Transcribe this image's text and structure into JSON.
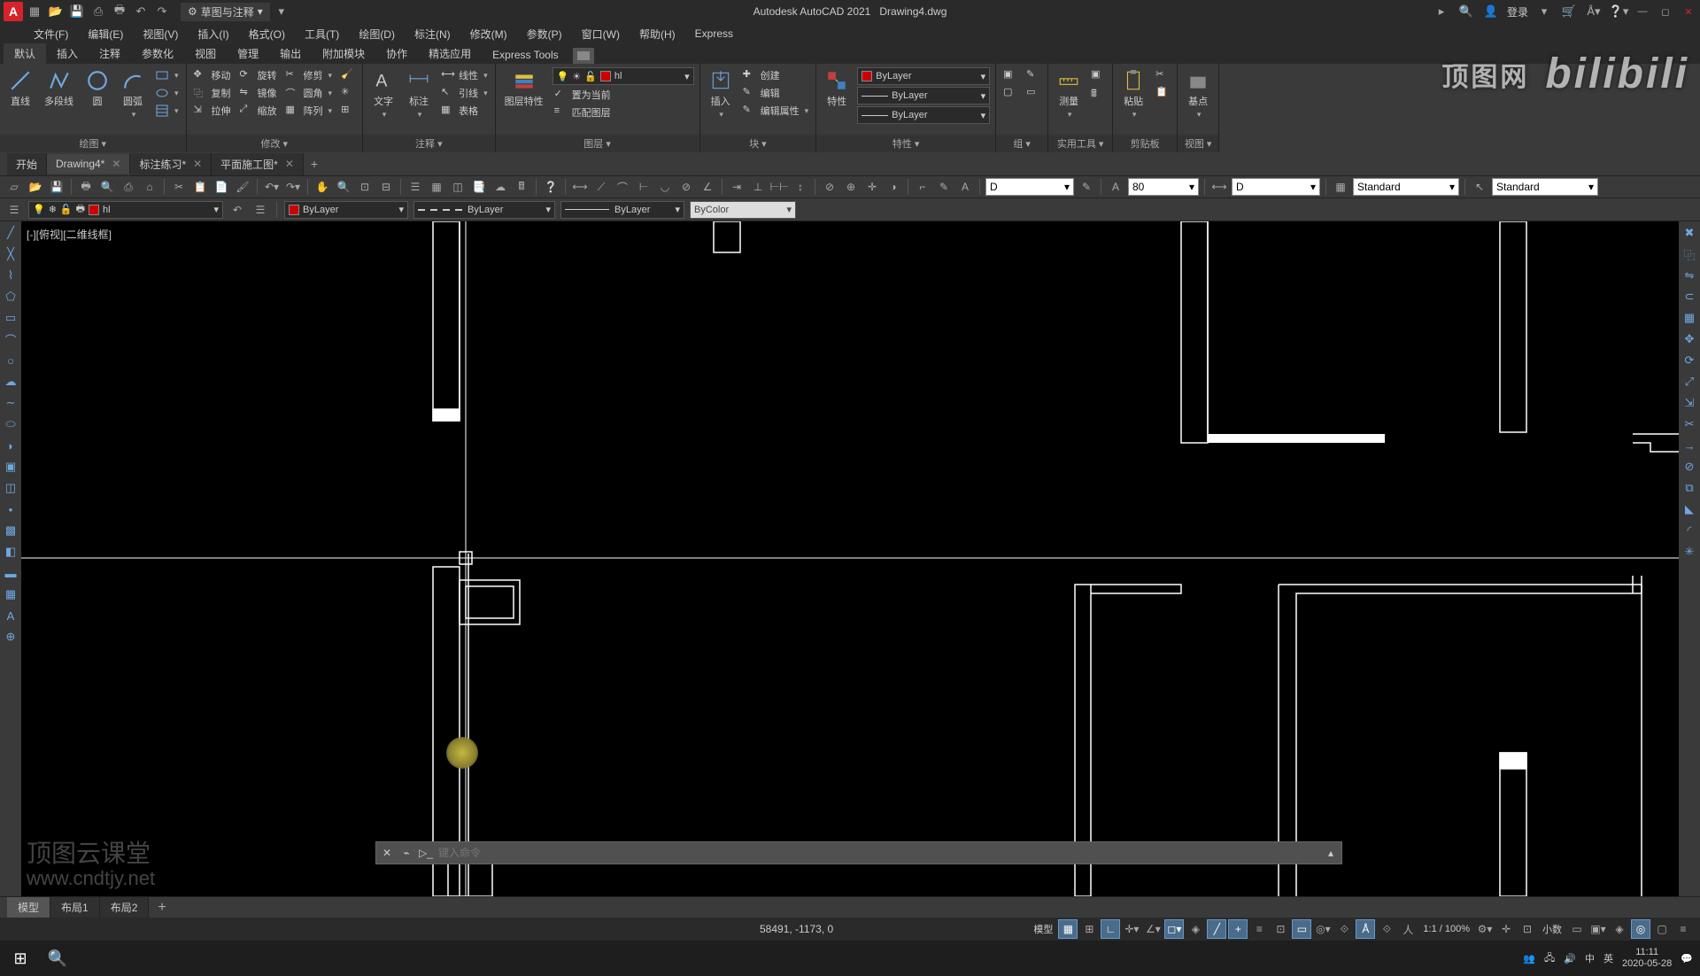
{
  "app": {
    "title": "Autodesk AutoCAD 2021",
    "file": "Drawing4.dwg",
    "logo": "A"
  },
  "workspace": "草图与注释",
  "qat": [
    "new",
    "open",
    "save",
    "saveas",
    "plot",
    "undo",
    "redo"
  ],
  "title_right": {
    "login": "登录"
  },
  "menus": [
    "文件(F)",
    "编辑(E)",
    "视图(V)",
    "插入(I)",
    "格式(O)",
    "工具(T)",
    "绘图(D)",
    "标注(N)",
    "修改(M)",
    "参数(P)",
    "窗口(W)",
    "帮助(H)",
    "Express"
  ],
  "ribbon_tabs": [
    "默认",
    "插入",
    "注释",
    "参数化",
    "视图",
    "管理",
    "输出",
    "附加模块",
    "协作",
    "精选应用",
    "Express Tools"
  ],
  "ribbon_active": 0,
  "ribbon_panels": {
    "draw": {
      "title": "绘图 ▾",
      "line": "直线",
      "pline": "多段线",
      "circle": "圆",
      "arc": "圆弧"
    },
    "modify": {
      "title": "修改 ▾",
      "move": "移动",
      "rotate": "旋转",
      "trim": "修剪",
      "copy": "复制",
      "mirror": "镜像",
      "fillet": "圆角",
      "stretch": "拉伸",
      "scale": "缩放",
      "array": "阵列"
    },
    "annot": {
      "title": "注释 ▾",
      "text": "文字",
      "dim": "标注",
      "linear": "线性",
      "leader": "引线",
      "table": "表格"
    },
    "layers": {
      "title": "图层 ▾",
      "props": "图层特性",
      "current": "hl",
      "make_current": "置为当前",
      "match": "匹配图层"
    },
    "block": {
      "title": "块 ▾",
      "insert": "插入",
      "create": "创建",
      "edit": "编辑",
      "edit_attr": "编辑属性"
    },
    "props": {
      "title": "特性 ▾",
      "match": "特性",
      "bylayer": "ByLayer"
    },
    "group": {
      "title": "组 ▾"
    },
    "utils": {
      "title": "实用工具 ▾",
      "measure": "测量"
    },
    "clip": {
      "title": "剪贴板",
      "paste": "粘贴"
    },
    "view": {
      "title": "视图 ▾",
      "base": "基点"
    }
  },
  "file_tabs": [
    {
      "name": "开始",
      "active": false,
      "close": false
    },
    {
      "name": "Drawing4*",
      "active": true,
      "close": true
    },
    {
      "name": "标注练习*",
      "active": false,
      "close": true
    },
    {
      "name": "平面施工图*",
      "active": false,
      "close": true
    }
  ],
  "toolbar_combos": {
    "dimstyle1": "D",
    "textsize": "80",
    "dimstyle2": "D",
    "tblstyle": "Standard",
    "mlstyle": "Standard"
  },
  "layer_strip": {
    "current": "hl",
    "color": "ByLayer",
    "ltype": "ByLayer",
    "lweight": "ByLayer",
    "plot": "ByColor"
  },
  "viewport_label": "[-][俯视][二维线框]",
  "command_placeholder": "键入命令",
  "model_tabs": [
    "模型",
    "布局1",
    "布局2"
  ],
  "model_active": 0,
  "status": {
    "coords": "58491, -1173, 0",
    "model": "模型",
    "zoom": "1:1 / 100%",
    "units": "小数"
  },
  "clock": {
    "time": "11:11",
    "date": "2020-05-28",
    "ime1": "中",
    "ime2": "英"
  },
  "watermark": {
    "dtw": "顶图网",
    "bili": "bilibili",
    "course": "顶图云课堂",
    "url": "www.cndtjy.net"
  }
}
